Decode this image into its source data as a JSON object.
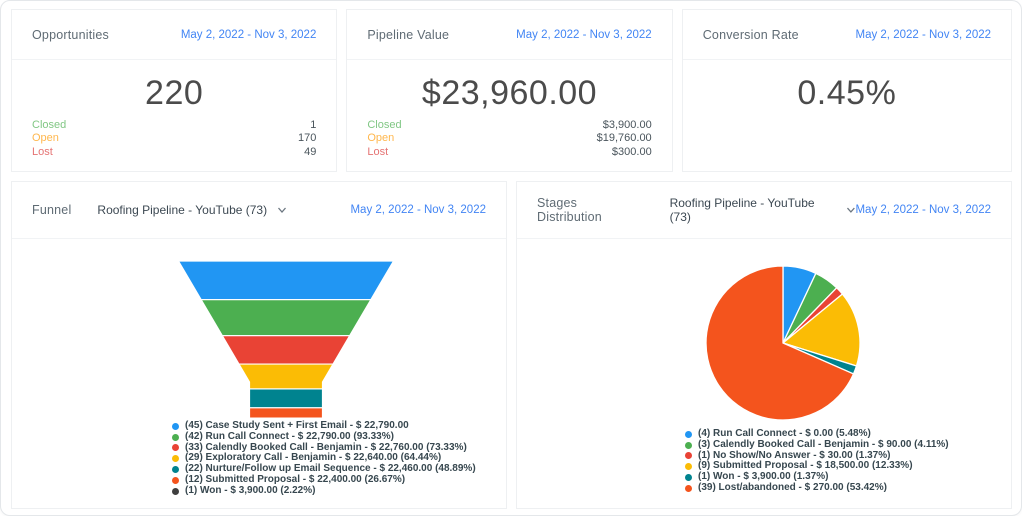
{
  "date_range": "May 2, 2022 - Nov 3, 2022",
  "palette": {
    "blue": "#2196F3",
    "green": "#4CAF50",
    "red": "#E94335",
    "amber": "#FBBC05",
    "teal": "#00838F",
    "orange": "#F4541D",
    "dark": "#3F3F3F",
    "date_link_blue": "#4285F4",
    "closed_green": "#81C784",
    "open_orange": "#FFB74D",
    "lost_red": "#E57373"
  },
  "stat_cards": [
    {
      "title": "Opportunities",
      "date_range": "May 2, 2022 - Nov 3, 2022",
      "value": "220",
      "rows": [
        {
          "label": "Closed",
          "value": "1"
        },
        {
          "label": "Open",
          "value": "170"
        },
        {
          "label": "Lost",
          "value": "49"
        }
      ]
    },
    {
      "title": "Pipeline Value",
      "date_range": "May 2, 2022 - Nov 3, 2022",
      "value": "$23,960.00",
      "rows": [
        {
          "label": "Closed",
          "value": "$3,900.00"
        },
        {
          "label": "Open",
          "value": "$19,760.00"
        },
        {
          "label": "Lost",
          "value": "$300.00"
        }
      ]
    },
    {
      "title": "Conversion Rate",
      "date_range": "May 2, 2022 - Nov 3, 2022",
      "value": "0.45%",
      "rows": []
    }
  ],
  "funnel_card": {
    "title": "Funnel",
    "pipeline_selector": "Roofing Pipeline - YouTube (73)",
    "date_range": "May 2, 2022 - Nov 3, 2022"
  },
  "stages_card": {
    "title": "Stages Distribution",
    "pipeline_selector": "Roofing Pipeline - YouTube (73)",
    "date_range": "May 2, 2022 - Nov 3, 2022"
  },
  "chart_data": [
    {
      "type": "funnel",
      "title": "Funnel",
      "pipeline": "Roofing Pipeline - YouTube (73)",
      "series": [
        {
          "name": "Case Study Sent + First Email",
          "count": 45,
          "amount": 22790.0,
          "percent": null,
          "color": "#2196F3",
          "label": "(45) Case Study Sent + First Email - $ 22,790.00"
        },
        {
          "name": "Run Call Connect",
          "count": 42,
          "amount": 22790.0,
          "percent": 93.33,
          "color": "#4CAF50",
          "label": "(42) Run Call Connect - $ 22,790.00 (93.33%)"
        },
        {
          "name": "Calendly Booked Call - Benjamin",
          "count": 33,
          "amount": 22760.0,
          "percent": 73.33,
          "color": "#E94335",
          "label": "(33) Calendly Booked Call - Benjamin - $ 22,760.00 (73.33%)"
        },
        {
          "name": "Exploratory Call - Benjamin",
          "count": 29,
          "amount": 22640.0,
          "percent": 64.44,
          "color": "#FBBC05",
          "label": "(29) Exploratory Call - Benjamin - $ 22,640.00 (64.44%)"
        },
        {
          "name": "Nurture/Follow up Email Sequence",
          "count": 22,
          "amount": 22460.0,
          "percent": 48.89,
          "color": "#00838F",
          "label": "(22) Nurture/Follow up Email Sequence - $ 22,460.00 (48.89%)"
        },
        {
          "name": "Submitted Proposal",
          "count": 12,
          "amount": 22400.0,
          "percent": 26.67,
          "color": "#F4541D",
          "label": "(12) Submitted Proposal - $ 22,400.00 (26.67%)"
        },
        {
          "name": "Won",
          "count": 1,
          "amount": 3900.0,
          "percent": 2.22,
          "color": "#3F3F3F",
          "label": "(1) Won - $ 3,900.00 (2.22%)"
        }
      ]
    },
    {
      "type": "pie",
      "title": "Stages Distribution",
      "pipeline": "Roofing Pipeline - YouTube (73)",
      "legend_position": "bottom",
      "series": [
        {
          "name": "Run Call Connect",
          "count": 4,
          "amount": 0.0,
          "percent": 5.48,
          "color": "#2196F3",
          "label": "(4) Run Call Connect - $ 0.00 (5.48%)"
        },
        {
          "name": "Calendly Booked Call - Benjamin",
          "count": 3,
          "amount": 90.0,
          "percent": 4.11,
          "color": "#4CAF50",
          "label": "(3) Calendly Booked Call - Benjamin - $ 90.00 (4.11%)"
        },
        {
          "name": "No Show/No Answer",
          "count": 1,
          "amount": 30.0,
          "percent": 1.37,
          "color": "#E94335",
          "label": "(1) No Show/No Answer - $ 30.00 (1.37%)"
        },
        {
          "name": "Submitted Proposal",
          "count": 9,
          "amount": 18500.0,
          "percent": 12.33,
          "color": "#FBBC05",
          "label": "(9) Submitted Proposal - $ 18,500.00 (12.33%)"
        },
        {
          "name": "Won",
          "count": 1,
          "amount": 3900.0,
          "percent": 1.37,
          "color": "#00838F",
          "label": "(1) Won - $ 3,900.00 (1.37%)"
        },
        {
          "name": "Lost/abandoned",
          "count": 39,
          "amount": 270.0,
          "percent": 53.42,
          "color": "#F4541D",
          "label": "(39) Lost/abandoned - $ 270.00 (53.42%)"
        }
      ]
    }
  ]
}
